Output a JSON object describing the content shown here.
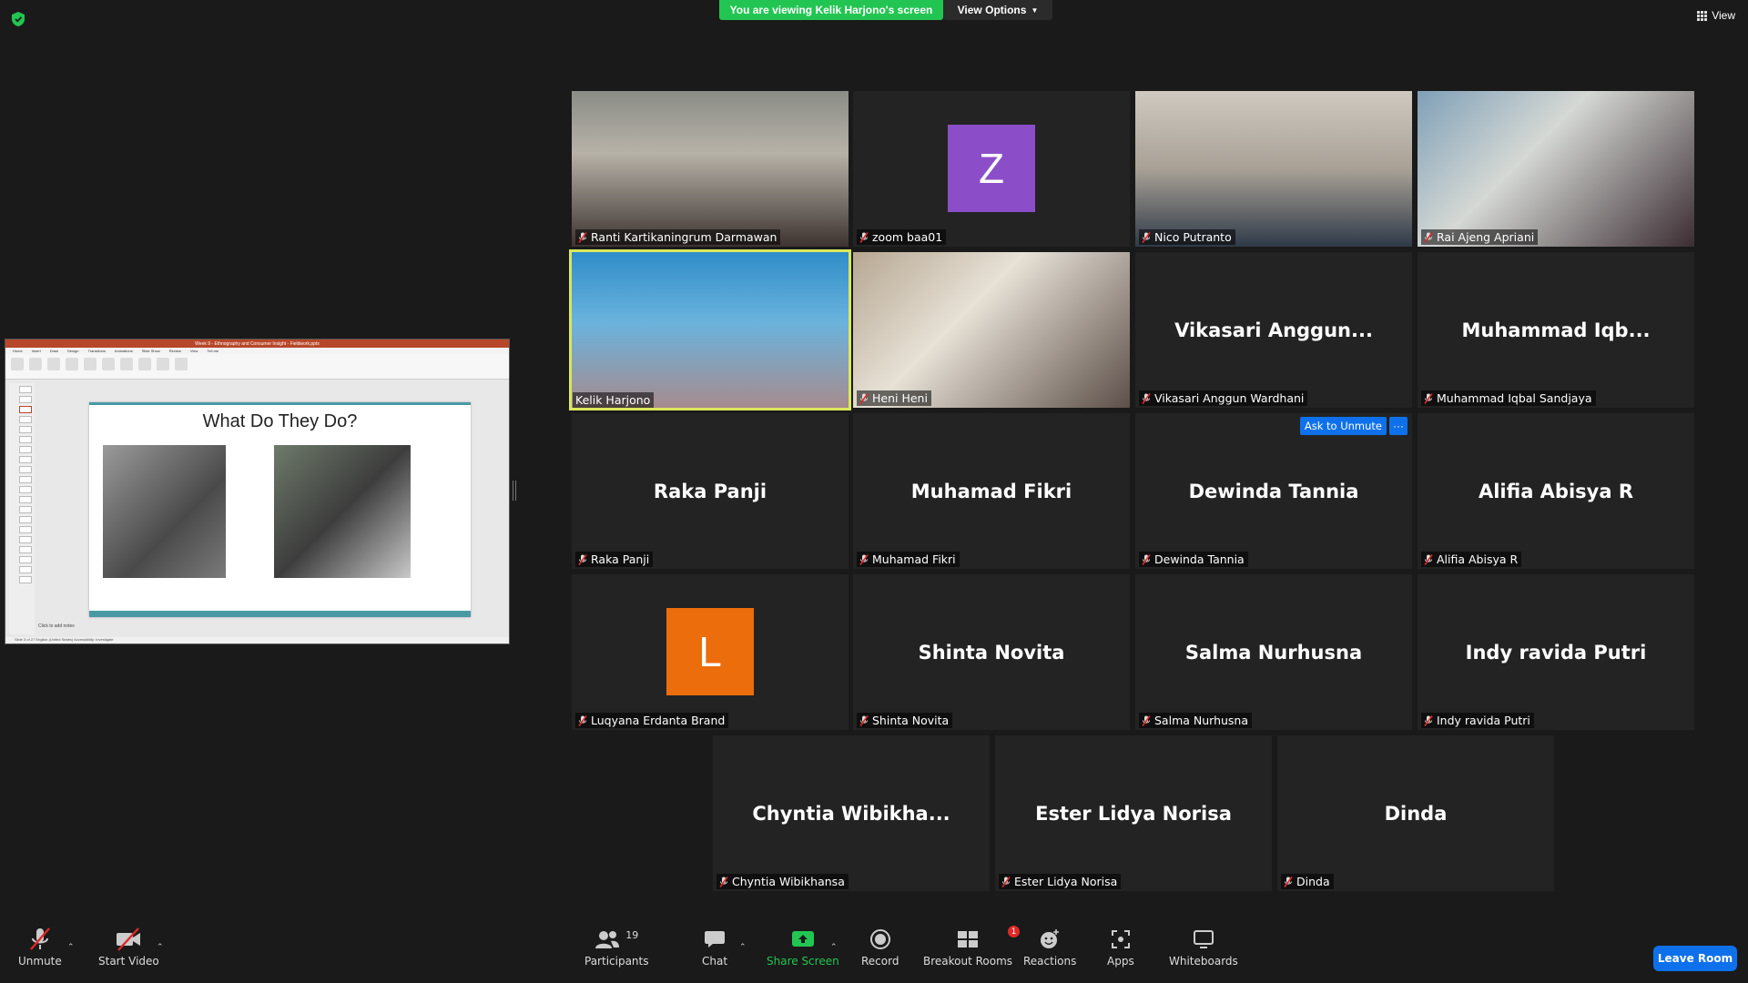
{
  "banner": {
    "viewing": "You are viewing Kelik Harjono's screen",
    "view_options": "View Options",
    "view": "View"
  },
  "share": {
    "window_title": "Week 9 - Ethnography and Consumer Insight - Fieldwork.pptx",
    "ribbon_tabs": [
      "Home",
      "Insert",
      "Draw",
      "Design",
      "Transitions",
      "Animations",
      "Slide Show",
      "Review",
      "View",
      "Tell me"
    ],
    "slide_title": "What Do They Do?",
    "notes": "Click to add notes",
    "status": "Slide 3 of 27   English (United States)   Accessibility: Investigate"
  },
  "tiles": [
    {
      "name": "Ranti Kartikaningrum Darmawan",
      "video": "video-ranti"
    },
    {
      "name": "zoom baa01",
      "avatar": "Z",
      "avatar_color": "#8b4ec8"
    },
    {
      "name": "Nico Putranto",
      "video": "video-nico"
    },
    {
      "name": "Rai Ajeng Apriani",
      "video": "video-rai"
    },
    {
      "name": "Kelik Harjono",
      "video": "video-kelik",
      "active": true
    },
    {
      "name": "Heni Heni",
      "video": "video-heni"
    },
    {
      "name": "Vikasari Anggun Wardhani",
      "big": "Vikasari  Anggun..."
    },
    {
      "name": "Muhammad Iqbal Sandjaya",
      "big": "Muhammad  Iqb..."
    },
    {
      "name": "Raka Panji",
      "big": "Raka Panji"
    },
    {
      "name": "Muhamad Fikri",
      "big": "Muhamad Fikri"
    },
    {
      "name": "Dewinda Tannia",
      "big": "Dewinda Tannia",
      "ask": "Ask to Unmute",
      "more": "···"
    },
    {
      "name": "Alifia Abisya R",
      "big": "Alifia Abisya R"
    },
    {
      "name": "Luqyana Erdanta Brand",
      "avatar": "L",
      "avatar_color": "#ec6d0b"
    },
    {
      "name": "Shinta Novita",
      "big": "Shinta Novita"
    },
    {
      "name": "Salma Nurhusna",
      "big": "Salma Nurhusna"
    },
    {
      "name": "Indy ravida Putri",
      "big": "Indy ravida Putri"
    },
    {
      "name": "Chyntia Wibikhansa",
      "big": "Chyntia  Wibikha..."
    },
    {
      "name": "Ester Lidya Norisa",
      "big": "Ester Lidya Norisa"
    },
    {
      "name": "Dinda",
      "big": "Dinda"
    }
  ],
  "toolbar": {
    "unmute": "Unmute",
    "start_video": "Start Video",
    "participants": "Participants",
    "participants_count": "19",
    "chat": "Chat",
    "share_screen": "Share Screen",
    "record": "Record",
    "breakout_rooms": "Breakout Rooms",
    "breakout_badge": "1",
    "reactions": "Reactions",
    "apps": "Apps",
    "whiteboards": "Whiteboards",
    "leave_room": "Leave Room"
  },
  "colors": {
    "accent_green": "#23c552",
    "accent_blue": "#0e71eb",
    "active_border": "#d9e85a",
    "mic_red": "#e02828"
  }
}
